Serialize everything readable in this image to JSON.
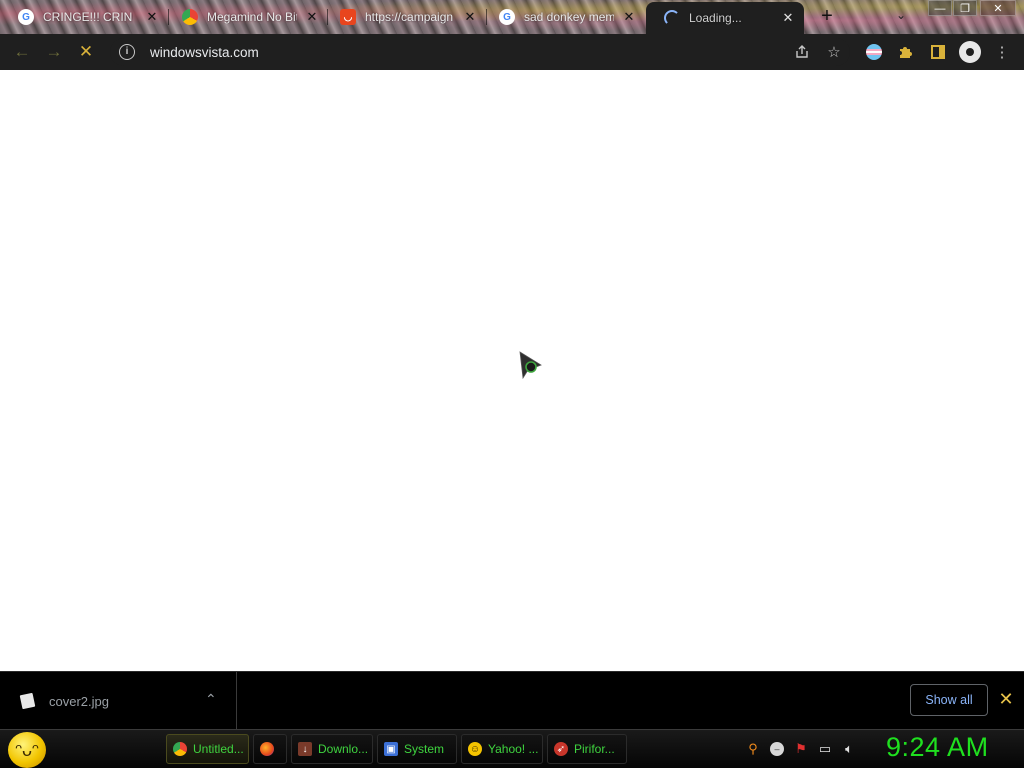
{
  "tabs": [
    {
      "title": "CRINGE!!! CRINGE!!! CRINGE",
      "favicon": "google-g-icon"
    },
    {
      "title": "Megamind No Bitches",
      "favicon": "chrome-icon"
    },
    {
      "title": "https://campaign",
      "favicon": "store-bag-icon"
    },
    {
      "title": "sad donkey meme",
      "favicon": "google-g-icon"
    },
    {
      "title": "Loading...",
      "favicon": "loading-spinner-icon",
      "active": true
    }
  ],
  "window_controls": {
    "minimize": "—",
    "maximize": "❐",
    "close": "✕"
  },
  "toolbar": {
    "url": "windowsvista.com",
    "back": "←",
    "forward": "→",
    "stop": "✕",
    "site_info": "i"
  },
  "download_bar": {
    "file_name": "cover2.jpg",
    "show_all_label": "Show all",
    "close": "✕"
  },
  "taskbar": {
    "items": [
      {
        "label": "Untitled...",
        "icon": "chrome-icon",
        "active": true
      },
      {
        "label": "",
        "icon": "firefox-icon"
      },
      {
        "label": "Downlo...",
        "icon": "download-folder-icon"
      },
      {
        "label": "System",
        "icon": "system-monitor-icon"
      },
      {
        "label": "Yahoo! ...",
        "icon": "yahoo-smiley-icon"
      },
      {
        "label": "Pirifor...",
        "icon": "piriform-icon"
      }
    ],
    "clock": "9:24 AM"
  },
  "colors": {
    "accent_green": "#1fe01f",
    "link_blue": "#8ab4f8",
    "close_yellow": "#e8c34a"
  }
}
